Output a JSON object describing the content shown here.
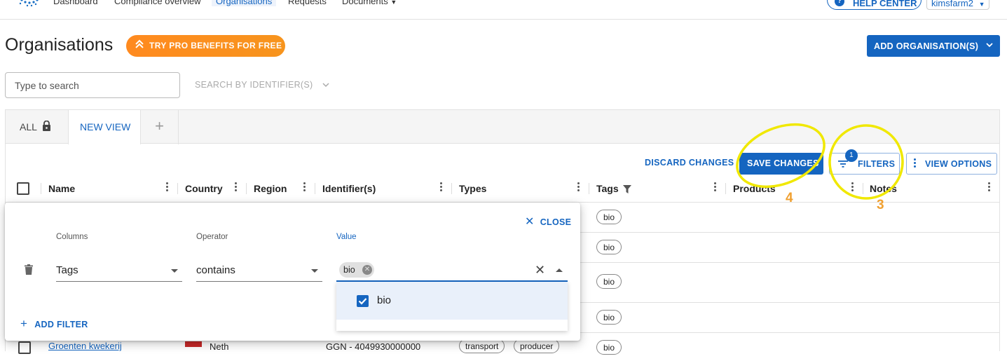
{
  "nav": {
    "items": [
      "Dashboard",
      "Compliance overview",
      "Organisations",
      "Requests",
      "Documents"
    ],
    "help_label": "HELP CENTER",
    "help_icon": "question-icon",
    "user_label": "kimsfarm2"
  },
  "header": {
    "title": "Organisations",
    "pro_label": "TRY PRO BENEFITS FOR FREE",
    "add_label": "ADD ORGANISATION(S)"
  },
  "search": {
    "placeholder": "Type to search",
    "identifier_label": "SEARCH BY IDENTIFIER(S)"
  },
  "tabs": {
    "all_label": "ALL",
    "new_view_label": "NEW VIEW",
    "add_label": "+"
  },
  "toolbar": {
    "discard_label": "DISCARD CHANGES",
    "save_label": "SAVE CHANGES",
    "filters_label": "FILTERS",
    "filters_count": "1",
    "view_options_label": "VIEW OPTIONS"
  },
  "table": {
    "columns": [
      "Name",
      "Country",
      "Region",
      "Identifier(s)",
      "Types",
      "Tags",
      "Products",
      "Notes"
    ],
    "rows": [
      {
        "tags": [
          "bio"
        ]
      },
      {
        "tags": [
          "bio"
        ]
      },
      {
        "tags": [
          "bio"
        ]
      },
      {
        "tags": [
          "bio"
        ]
      },
      {
        "name": "Groenten kwekerij",
        "country": "Neth",
        "identifier": "GGN - 4049930000000",
        "types": [
          "transport",
          "producer"
        ],
        "tags": [
          "bio"
        ]
      }
    ]
  },
  "filter_panel": {
    "close_label": "CLOSE",
    "columns_label": "Columns",
    "operator_label": "Operator",
    "value_label": "Value",
    "column_value": "Tags",
    "operator_value": "contains",
    "selected_value": "bio",
    "options": [
      {
        "label": "bio",
        "checked": true
      }
    ],
    "add_filter_label": "ADD FILTER"
  },
  "annotations": {
    "labels": [
      "4",
      "3"
    ],
    "color": "#f0e800",
    "number_color": "#f0a030"
  }
}
